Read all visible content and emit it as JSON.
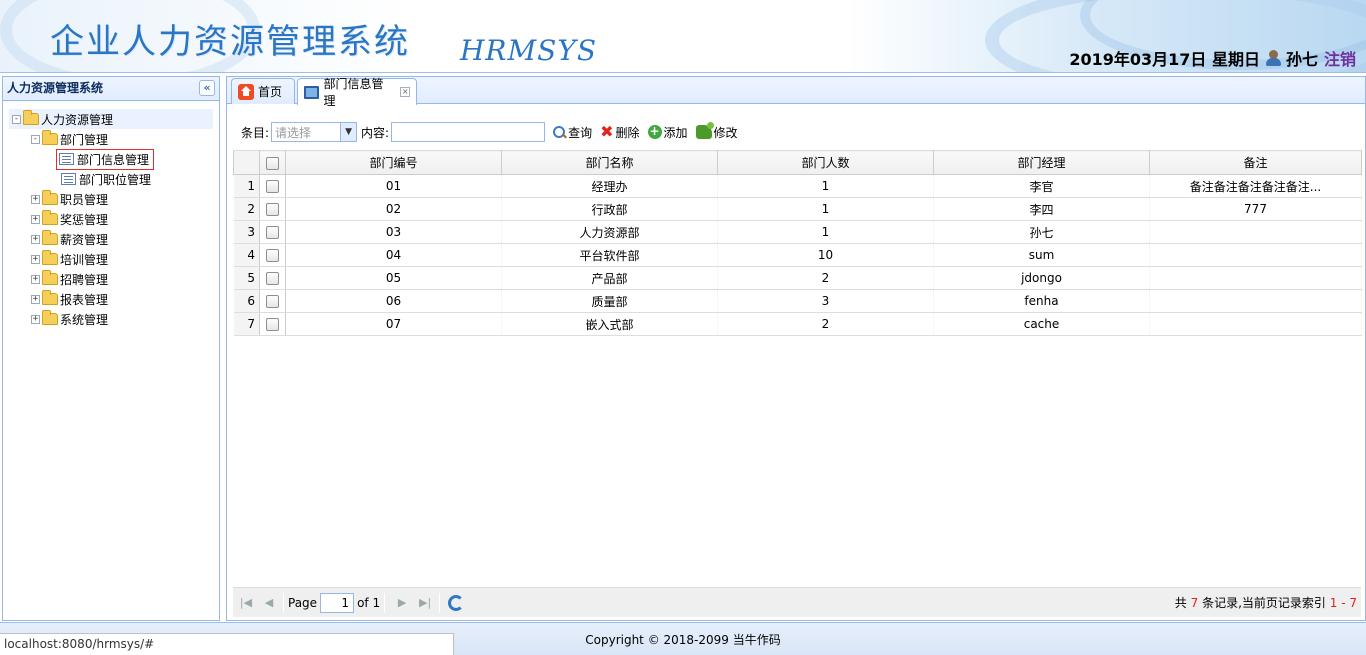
{
  "header": {
    "app_title": "企业人力资源管理系统",
    "logo_text": "HRMSYS",
    "date": "2019年03月17日 星期日",
    "username": "孙七",
    "logout": "注销"
  },
  "sidebar": {
    "title": "人力资源管理系统",
    "collapse_icon": "double-chevron-left-icon",
    "tree": {
      "root": "人力资源管理",
      "dept": "部门管理",
      "dept_info": "部门信息管理",
      "dept_position": "部门职位管理",
      "employee": "职员管理",
      "reward": "奖惩管理",
      "salary": "薪资管理",
      "training": "培训管理",
      "recruit": "招聘管理",
      "report": "报表管理",
      "system": "系统管理"
    }
  },
  "tabs": {
    "home": "首页",
    "dept_info": "部门信息管理"
  },
  "toolbar": {
    "field_label": "条目:",
    "select_placeholder": "请选择",
    "content_label": "内容:",
    "search": "查询",
    "delete": "删除",
    "add": "添加",
    "edit": "修改"
  },
  "table": {
    "columns": [
      "部门编号",
      "部门名称",
      "部门人数",
      "部门经理",
      "备注"
    ],
    "rows": [
      {
        "n": "1",
        "id": "01",
        "name": "经理办",
        "count": "1",
        "manager": "李官",
        "note": "备注备注备注备注备注..."
      },
      {
        "n": "2",
        "id": "02",
        "name": "行政部",
        "count": "1",
        "manager": "李四",
        "note": "777"
      },
      {
        "n": "3",
        "id": "03",
        "name": "人力资源部",
        "count": "1",
        "manager": "孙七",
        "note": ""
      },
      {
        "n": "4",
        "id": "04",
        "name": "平台软件部",
        "count": "10",
        "manager": "sum",
        "note": ""
      },
      {
        "n": "5",
        "id": "05",
        "name": "产品部",
        "count": "2",
        "manager": "jdongo",
        "note": ""
      },
      {
        "n": "6",
        "id": "06",
        "name": "质量部",
        "count": "3",
        "manager": "fenha",
        "note": ""
      },
      {
        "n": "7",
        "id": "07",
        "name": "嵌入式部",
        "count": "2",
        "manager": "cache",
        "note": ""
      }
    ]
  },
  "pager": {
    "page_label": "Page",
    "page_value": "1",
    "of_label": "of 1",
    "info_prefix": "共",
    "total": "7",
    "info_mid": "条记录,当前页记录索引",
    "range": "1 - 7"
  },
  "footer": {
    "copyright": "Copyright © 2018-2099 当牛作码",
    "status_url": "localhost:8080/hrmsys/#"
  }
}
